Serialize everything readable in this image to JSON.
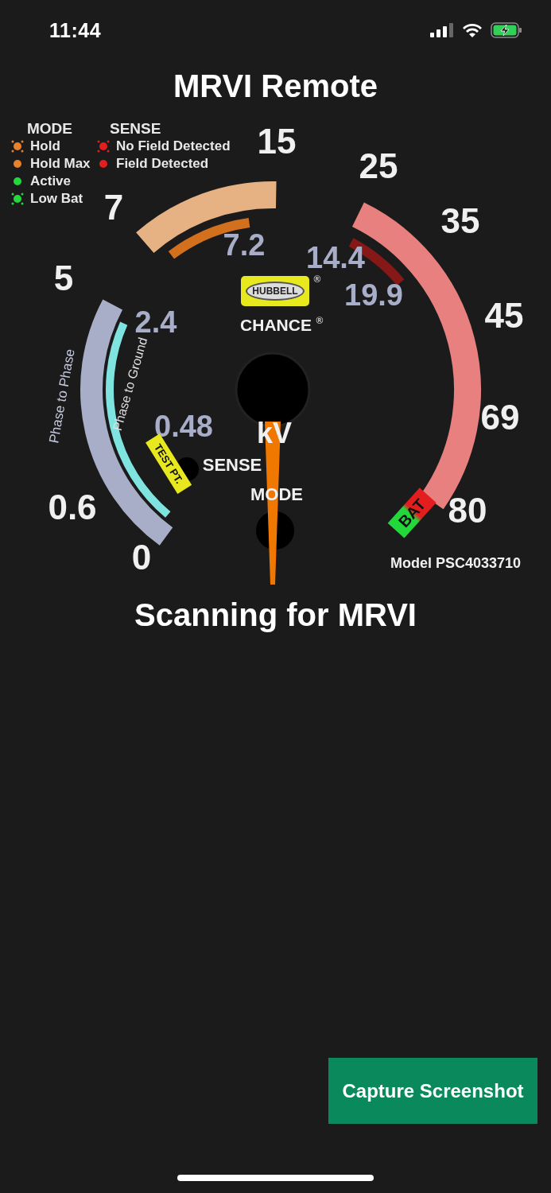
{
  "status_bar": {
    "time": "11:44",
    "charging": true
  },
  "title": "MRVI Remote",
  "gauge": {
    "mode_heading": "MODE",
    "mode_legend": [
      {
        "label": "Hold",
        "color": "#e8822a",
        "blinking": true
      },
      {
        "label": "Hold Max",
        "color": "#e8822a",
        "blinking": false
      },
      {
        "label": "Active",
        "color": "#22d83a",
        "blinking": false
      },
      {
        "label": "Low Bat",
        "color": "#22d83a",
        "blinking": true
      }
    ],
    "sense_heading": "SENSE",
    "sense_legend": [
      {
        "label": "No Field Detected",
        "color": "#e41e1e",
        "blinking": true
      },
      {
        "label": "Field Detected",
        "color": "#e41e1e",
        "blinking": false
      }
    ],
    "scale_labels": [
      {
        "text": "15",
        "kind": "major"
      },
      {
        "text": "7",
        "kind": "major"
      },
      {
        "text": "7.2",
        "kind": "minor"
      },
      {
        "text": "25",
        "kind": "major"
      },
      {
        "text": "35",
        "kind": "major"
      },
      {
        "text": "14.4",
        "kind": "minor"
      },
      {
        "text": "19.9",
        "kind": "minor"
      },
      {
        "text": "45",
        "kind": "major"
      },
      {
        "text": "5",
        "kind": "major"
      },
      {
        "text": "2.4",
        "kind": "minor"
      },
      {
        "text": "0.48",
        "kind": "minor"
      },
      {
        "text": "69",
        "kind": "major"
      },
      {
        "text": "0.6",
        "kind": "major"
      },
      {
        "text": "0",
        "kind": "major"
      },
      {
        "text": "80",
        "kind": "major"
      }
    ],
    "band_labels": [
      "Phase to Phase",
      "Phase to Ground",
      "TEST PT.",
      "BAT"
    ],
    "logo_top": "HUBBELL",
    "logo_bottom": "CHANCE",
    "registered": "®",
    "unit": "kV",
    "sense_button": "SENSE",
    "mode_button": "MODE",
    "model": "Model PSC4033710"
  },
  "status_message": "Scanning for MRVI",
  "capture_button": "Capture Screenshot"
}
